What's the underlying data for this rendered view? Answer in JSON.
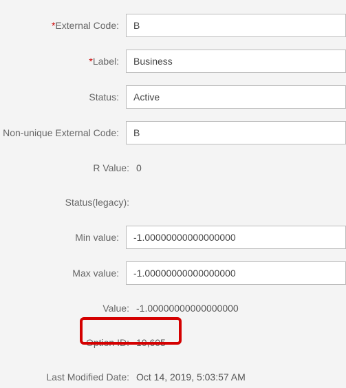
{
  "fields": {
    "external_code": {
      "label": "External Code:",
      "value": "B",
      "required": true
    },
    "label_field": {
      "label": "Label:",
      "value": "Business",
      "required": true
    },
    "status": {
      "label": "Status:",
      "value": "Active"
    },
    "nonunique": {
      "label": "Non-unique External Code:",
      "value": "B"
    },
    "r_value": {
      "label": "R Value:",
      "value": "0"
    },
    "status_legacy": {
      "label": "Status(legacy):",
      "value": ""
    },
    "min_value": {
      "label": "Min value:",
      "value": "-1.00000000000000000"
    },
    "max_value": {
      "label": "Max value:",
      "value": "-1.00000000000000000"
    },
    "value_field": {
      "label": "Value:",
      "value": "-1.00000000000000000"
    },
    "option_id": {
      "label": "Option ID:",
      "value": "10,605"
    },
    "last_modified": {
      "label": "Last Modified Date:",
      "value": "Oct 14, 2019, 5:03:57 AM"
    }
  }
}
